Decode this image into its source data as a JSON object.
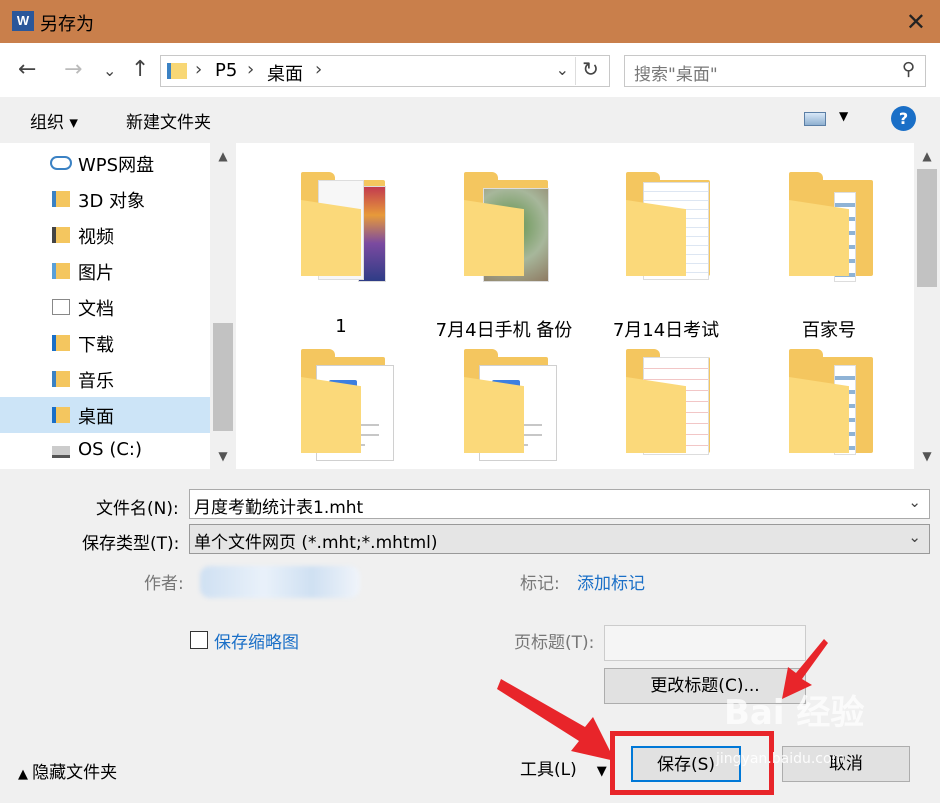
{
  "window": {
    "title": "另存为",
    "app_icon": "word-icon",
    "close_label": "✕"
  },
  "nav": {
    "back_icon": "←",
    "forward_icon": "→",
    "history_icon": "⌄",
    "up_icon": "↑",
    "breadcrumb": [
      "P5",
      "桌面"
    ],
    "refresh_icon": "↻",
    "search_placeholder": "搜索\"桌面\""
  },
  "toolbar": {
    "organize": "组织 ▾",
    "new_folder": "新建文件夹",
    "help": "?"
  },
  "sidebar": {
    "items": [
      {
        "label": "WPS网盘",
        "icon": "cloud-icon"
      },
      {
        "label": "3D 对象",
        "icon": "cube-folder-icon"
      },
      {
        "label": "视频",
        "icon": "video-folder-icon"
      },
      {
        "label": "图片",
        "icon": "pictures-folder-icon"
      },
      {
        "label": "文档",
        "icon": "documents-folder-icon"
      },
      {
        "label": "下载",
        "icon": "downloads-folder-icon"
      },
      {
        "label": "音乐",
        "icon": "music-folder-icon"
      },
      {
        "label": "桌面",
        "icon": "desktop-folder-icon",
        "selected": true
      },
      {
        "label": "OS (C:)",
        "icon": "drive-icon"
      }
    ]
  },
  "files": [
    {
      "name": "1",
      "type": "folder-photos"
    },
    {
      "name": "7月4日手机 备份",
      "type": "folder-plants"
    },
    {
      "name": "7月14日考试",
      "type": "folder-docs"
    },
    {
      "name": "百家号",
      "type": "folder-pages"
    },
    {
      "name": "",
      "type": "folder-word"
    },
    {
      "name": "",
      "type": "folder-word"
    },
    {
      "name": "",
      "type": "folder-doc-red"
    },
    {
      "name": "",
      "type": "folder-pages"
    }
  ],
  "form": {
    "filename_label": "文件名(N):",
    "filename_value": "月度考勤统计表1.mht",
    "filetype_label": "保存类型(T):",
    "filetype_value": "单个文件网页 (*.mht;*.mhtml)",
    "author_label": "作者:",
    "tags_label": "标记:",
    "tags_link": "添加标记",
    "thumbnail_label": "保存缩略图",
    "page_title_label": "页标题(T):",
    "change_title_button": "更改标题(C)...",
    "hide_folders": "隐藏文件夹",
    "tools_label": "工具(L)",
    "save_button": "保存(S)",
    "cancel_button": "取消"
  },
  "watermark": {
    "text": "Bai 经验",
    "sub": "jingyan.baidu.com"
  },
  "colors": {
    "titlebar": "#c97f4b",
    "accent": "#0078d7",
    "link": "#1a6fc7",
    "highlight": "#e8252a"
  }
}
